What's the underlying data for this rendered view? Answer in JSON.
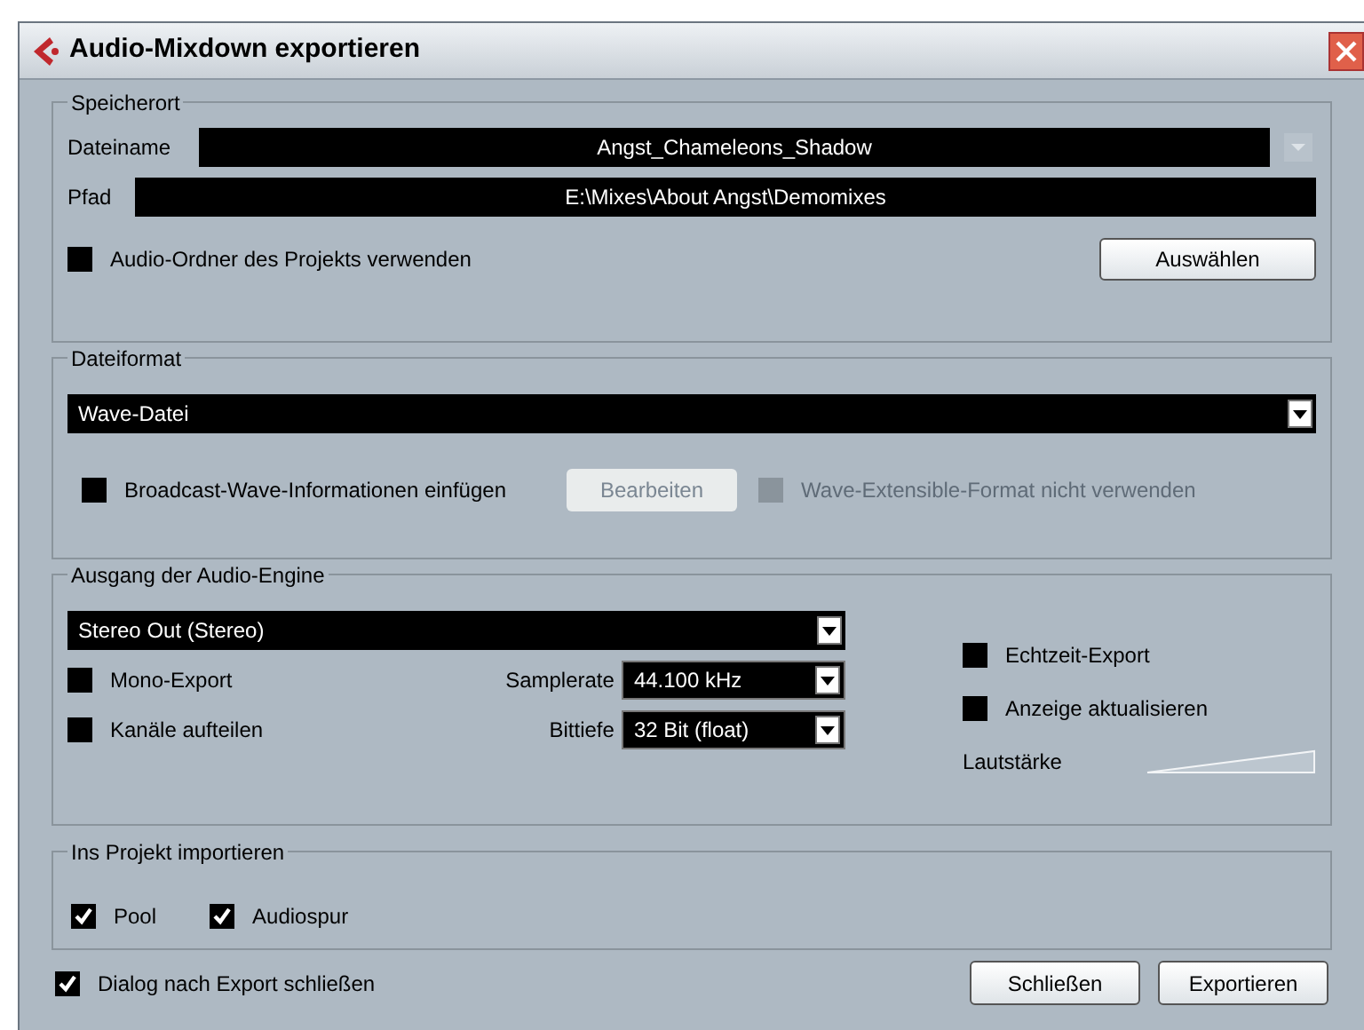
{
  "window": {
    "title": "Audio-Mixdown exportieren"
  },
  "location": {
    "legend": "Speicherort",
    "filename_label": "Dateiname",
    "filename": "Angst_Chameleons_Shadow",
    "path_label": "Pfad",
    "path": "E:\\Mixes\\About Angst\\Demomixes",
    "use_project_folder": {
      "label": "Audio-Ordner des Projekts verwenden",
      "checked": false
    },
    "choose_button": "Auswählen"
  },
  "file_format": {
    "legend": "Dateiformat",
    "format": "Wave-Datei",
    "broadcast": {
      "label": "Broadcast-Wave-Informationen einfügen",
      "checked": false,
      "disabled": false
    },
    "edit_button": {
      "label": "Bearbeiten",
      "disabled": true
    },
    "wave_extensible": {
      "label": "Wave-Extensible-Format nicht verwenden",
      "checked": false,
      "disabled": true
    }
  },
  "engine_output": {
    "legend": "Ausgang der Audio-Engine",
    "output": "Stereo Out (Stereo)",
    "mono": {
      "label": "Mono-Export",
      "checked": false
    },
    "split": {
      "label": "Kanäle aufteilen",
      "checked": false
    },
    "samplerate_label": "Samplerate",
    "samplerate": "44.100 kHz",
    "bitdepth_label": "Bittiefe",
    "bitdepth": "32 Bit (float)",
    "realtime": {
      "label": "Echtzeit-Export",
      "checked": false
    },
    "update_display": {
      "label": "Anzeige aktualisieren",
      "checked": false
    },
    "volume_label": "Lautstärke"
  },
  "import": {
    "legend": "Ins Projekt importieren",
    "pool": {
      "label": "Pool",
      "checked": true
    },
    "audio_track": {
      "label": "Audiospur",
      "checked": true
    }
  },
  "close_after_export": {
    "label": "Dialog nach Export schließen",
    "checked": true
  },
  "buttons": [
    "Schließen",
    "Exportieren"
  ]
}
